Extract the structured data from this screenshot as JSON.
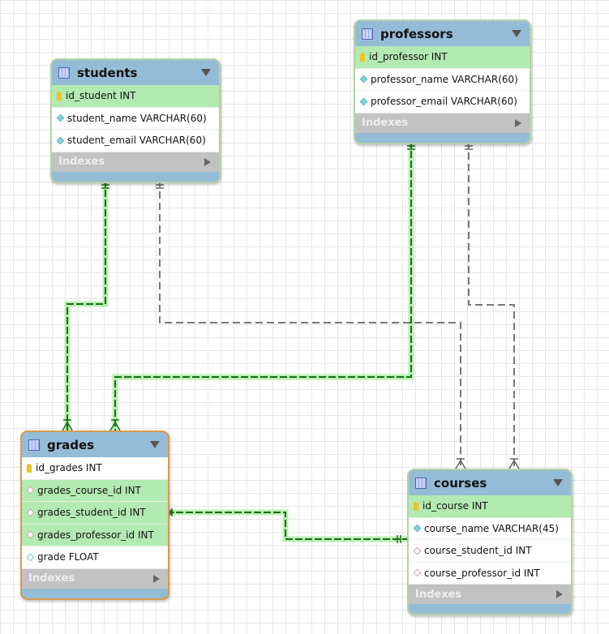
{
  "tables": {
    "students": {
      "name": "students",
      "columns": [
        {
          "label": "id_student INT",
          "icon": "primary-key-icon",
          "hl": true
        },
        {
          "label": "student_name VARCHAR(60)",
          "icon": "column-diamond-icon",
          "hl": false
        },
        {
          "label": "student_email VARCHAR(60)",
          "icon": "column-diamond-icon",
          "hl": false
        }
      ],
      "indexes": "Indexes"
    },
    "professors": {
      "name": "professors",
      "columns": [
        {
          "label": "id_professor INT",
          "icon": "primary-key-icon",
          "hl": true
        },
        {
          "label": "professor_name VARCHAR(60)",
          "icon": "column-diamond-icon",
          "hl": false
        },
        {
          "label": "professor_email VARCHAR(60)",
          "icon": "column-diamond-icon",
          "hl": false
        }
      ],
      "indexes": "Indexes"
    },
    "grades": {
      "name": "grades",
      "selected": true,
      "columns": [
        {
          "label": "id_grades INT",
          "icon": "primary-key-icon",
          "hl": false
        },
        {
          "label": "grades_course_id INT",
          "icon": "foreign-key-diamond-icon",
          "hl": true
        },
        {
          "label": "grades_student_id INT",
          "icon": "foreign-key-diamond-icon",
          "hl": true
        },
        {
          "label": "grades_professor_id INT",
          "icon": "foreign-key-diamond-icon",
          "hl": true
        },
        {
          "label": "grade FLOAT",
          "icon": "nullable-diamond-icon",
          "hl": false
        }
      ],
      "indexes": "Indexes"
    },
    "courses": {
      "name": "courses",
      "columns": [
        {
          "label": "id_course INT",
          "icon": "primary-key-icon",
          "hl": true
        },
        {
          "label": "course_name VARCHAR(45)",
          "icon": "column-diamond-icon",
          "hl": false
        },
        {
          "label": "course_student_id INT",
          "icon": "foreign-key-diamond-icon",
          "hl": false
        },
        {
          "label": "course_professor_id INT",
          "icon": "foreign-key-diamond-icon",
          "hl": false
        }
      ],
      "indexes": "Indexes"
    }
  },
  "relationships": [
    {
      "from": "students",
      "to": "grades",
      "highlighted": true
    },
    {
      "from": "professors",
      "to": "grades",
      "highlighted": true
    },
    {
      "from": "grades",
      "to": "courses",
      "highlighted": true
    },
    {
      "from": "students",
      "to": "courses",
      "highlighted": false
    },
    {
      "from": "professors",
      "to": "courses",
      "highlighted": false
    }
  ],
  "colors": {
    "highlight": "#1e8c1e",
    "glow": "#8fe68a",
    "dashed": "#777777",
    "header": "#95bcd7",
    "selected_border": "#d99a4e"
  }
}
